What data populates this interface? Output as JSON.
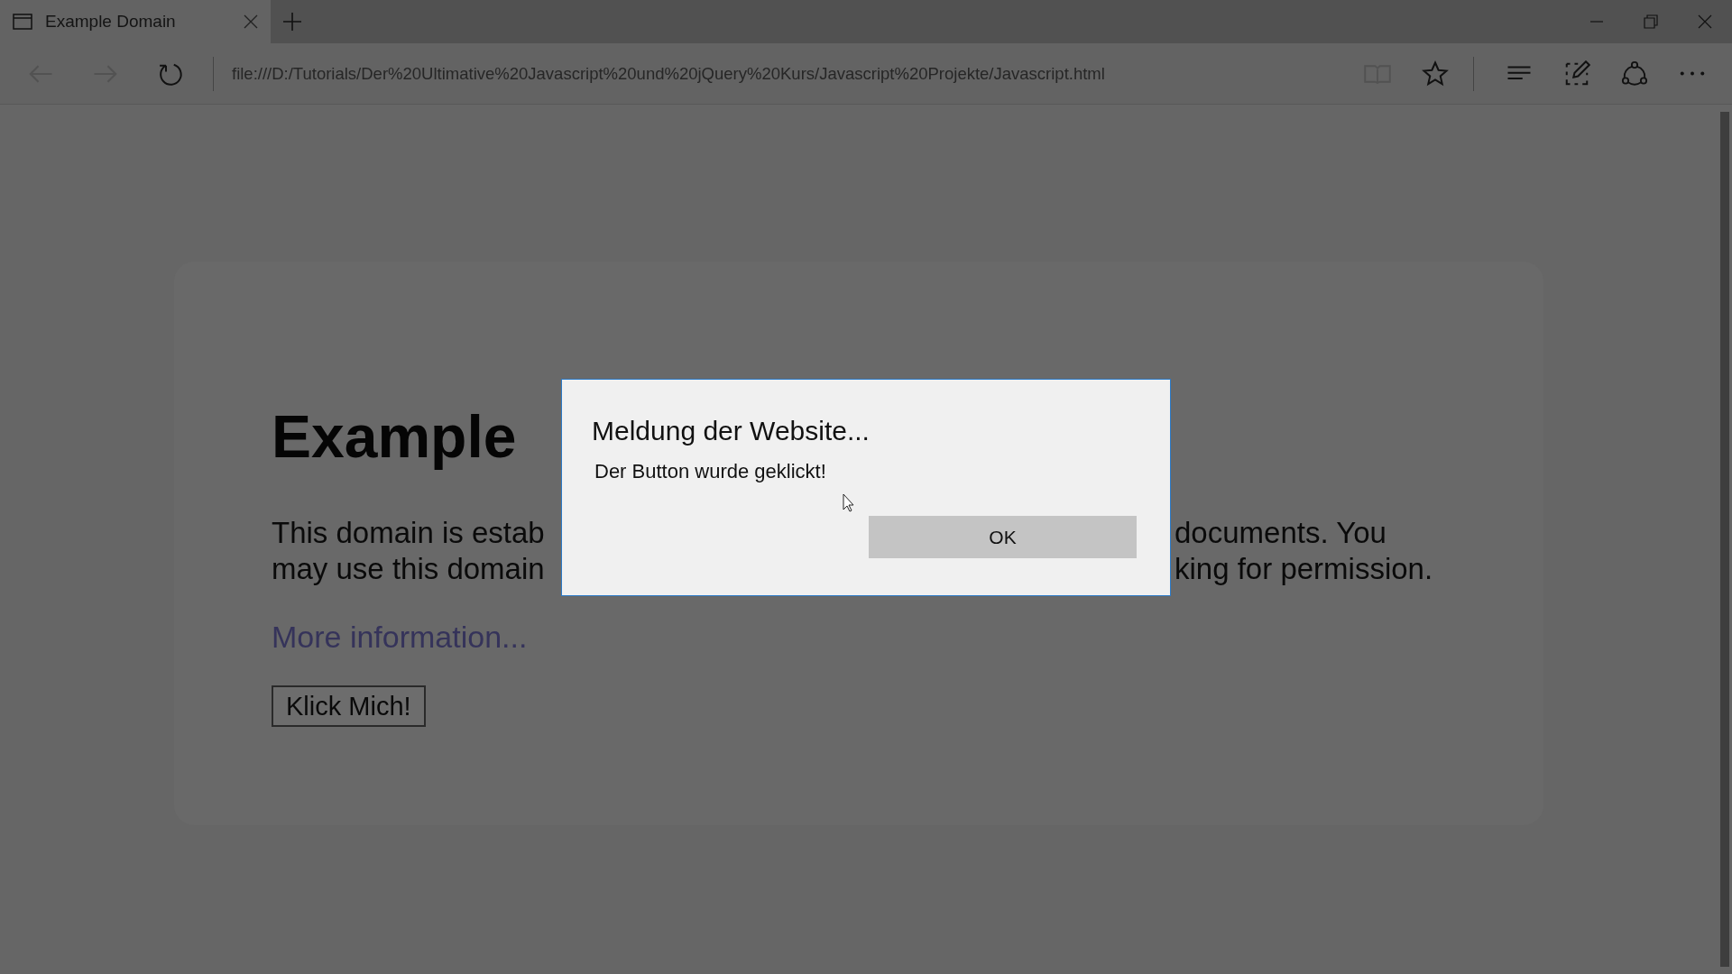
{
  "browser": {
    "tabs": [
      {
        "title": "Example Domain",
        "selected": true
      }
    ],
    "toolbar": {
      "nav": [
        {
          "kind": "back",
          "disabled": true
        },
        {
          "kind": "forward",
          "disabled": true
        },
        {
          "kind": "refresh",
          "disabled": false
        }
      ],
      "address": "file:///D:/Tutorials/Der%20Ultimative%20Javascript%20und%20jQuery%20Kurs/Javascript%20Projekte/Javascript.html",
      "actions": [
        {
          "kind": "reading",
          "disabled": true
        },
        {
          "kind": "favorite",
          "disabled": false
        },
        {
          "kind": "hub",
          "disabled": false
        },
        {
          "kind": "note",
          "disabled": false
        },
        {
          "kind": "share",
          "disabled": false
        },
        {
          "kind": "more",
          "disabled": false
        }
      ]
    }
  },
  "page": {
    "heading": "Example",
    "paragraph_lines": [
      {
        "left": "This domain is estab",
        "right": "documents. You"
      },
      {
        "left": "may use this domain",
        "right": "king for permission."
      }
    ],
    "link": "More information...",
    "button": "Klick Mich!"
  },
  "dialog": {
    "title": "Meldung der Website...",
    "message": "Der Button wurde geklickt!",
    "button": "OK"
  }
}
